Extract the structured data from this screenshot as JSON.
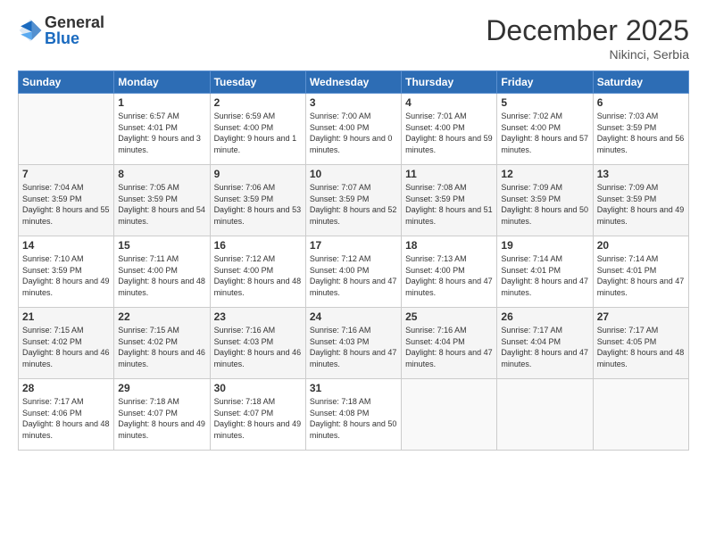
{
  "logo": {
    "text_general": "General",
    "text_blue": "Blue"
  },
  "header": {
    "month_year": "December 2025",
    "location": "Nikinci, Serbia"
  },
  "weekdays": [
    "Sunday",
    "Monday",
    "Tuesday",
    "Wednesday",
    "Thursday",
    "Friday",
    "Saturday"
  ],
  "weeks": [
    [
      {
        "day": "",
        "sunrise": "",
        "sunset": "",
        "daylight": ""
      },
      {
        "day": "1",
        "sunrise": "Sunrise: 6:57 AM",
        "sunset": "Sunset: 4:01 PM",
        "daylight": "Daylight: 9 hours and 3 minutes."
      },
      {
        "day": "2",
        "sunrise": "Sunrise: 6:59 AM",
        "sunset": "Sunset: 4:00 PM",
        "daylight": "Daylight: 9 hours and 1 minute."
      },
      {
        "day": "3",
        "sunrise": "Sunrise: 7:00 AM",
        "sunset": "Sunset: 4:00 PM",
        "daylight": "Daylight: 9 hours and 0 minutes."
      },
      {
        "day": "4",
        "sunrise": "Sunrise: 7:01 AM",
        "sunset": "Sunset: 4:00 PM",
        "daylight": "Daylight: 8 hours and 59 minutes."
      },
      {
        "day": "5",
        "sunrise": "Sunrise: 7:02 AM",
        "sunset": "Sunset: 4:00 PM",
        "daylight": "Daylight: 8 hours and 57 minutes."
      },
      {
        "day": "6",
        "sunrise": "Sunrise: 7:03 AM",
        "sunset": "Sunset: 3:59 PM",
        "daylight": "Daylight: 8 hours and 56 minutes."
      }
    ],
    [
      {
        "day": "7",
        "sunrise": "Sunrise: 7:04 AM",
        "sunset": "Sunset: 3:59 PM",
        "daylight": "Daylight: 8 hours and 55 minutes."
      },
      {
        "day": "8",
        "sunrise": "Sunrise: 7:05 AM",
        "sunset": "Sunset: 3:59 PM",
        "daylight": "Daylight: 8 hours and 54 minutes."
      },
      {
        "day": "9",
        "sunrise": "Sunrise: 7:06 AM",
        "sunset": "Sunset: 3:59 PM",
        "daylight": "Daylight: 8 hours and 53 minutes."
      },
      {
        "day": "10",
        "sunrise": "Sunrise: 7:07 AM",
        "sunset": "Sunset: 3:59 PM",
        "daylight": "Daylight: 8 hours and 52 minutes."
      },
      {
        "day": "11",
        "sunrise": "Sunrise: 7:08 AM",
        "sunset": "Sunset: 3:59 PM",
        "daylight": "Daylight: 8 hours and 51 minutes."
      },
      {
        "day": "12",
        "sunrise": "Sunrise: 7:09 AM",
        "sunset": "Sunset: 3:59 PM",
        "daylight": "Daylight: 8 hours and 50 minutes."
      },
      {
        "day": "13",
        "sunrise": "Sunrise: 7:09 AM",
        "sunset": "Sunset: 3:59 PM",
        "daylight": "Daylight: 8 hours and 49 minutes."
      }
    ],
    [
      {
        "day": "14",
        "sunrise": "Sunrise: 7:10 AM",
        "sunset": "Sunset: 3:59 PM",
        "daylight": "Daylight: 8 hours and 49 minutes."
      },
      {
        "day": "15",
        "sunrise": "Sunrise: 7:11 AM",
        "sunset": "Sunset: 4:00 PM",
        "daylight": "Daylight: 8 hours and 48 minutes."
      },
      {
        "day": "16",
        "sunrise": "Sunrise: 7:12 AM",
        "sunset": "Sunset: 4:00 PM",
        "daylight": "Daylight: 8 hours and 48 minutes."
      },
      {
        "day": "17",
        "sunrise": "Sunrise: 7:12 AM",
        "sunset": "Sunset: 4:00 PM",
        "daylight": "Daylight: 8 hours and 47 minutes."
      },
      {
        "day": "18",
        "sunrise": "Sunrise: 7:13 AM",
        "sunset": "Sunset: 4:00 PM",
        "daylight": "Daylight: 8 hours and 47 minutes."
      },
      {
        "day": "19",
        "sunrise": "Sunrise: 7:14 AM",
        "sunset": "Sunset: 4:01 PM",
        "daylight": "Daylight: 8 hours and 47 minutes."
      },
      {
        "day": "20",
        "sunrise": "Sunrise: 7:14 AM",
        "sunset": "Sunset: 4:01 PM",
        "daylight": "Daylight: 8 hours and 47 minutes."
      }
    ],
    [
      {
        "day": "21",
        "sunrise": "Sunrise: 7:15 AM",
        "sunset": "Sunset: 4:02 PM",
        "daylight": "Daylight: 8 hours and 46 minutes."
      },
      {
        "day": "22",
        "sunrise": "Sunrise: 7:15 AM",
        "sunset": "Sunset: 4:02 PM",
        "daylight": "Daylight: 8 hours and 46 minutes."
      },
      {
        "day": "23",
        "sunrise": "Sunrise: 7:16 AM",
        "sunset": "Sunset: 4:03 PM",
        "daylight": "Daylight: 8 hours and 46 minutes."
      },
      {
        "day": "24",
        "sunrise": "Sunrise: 7:16 AM",
        "sunset": "Sunset: 4:03 PM",
        "daylight": "Daylight: 8 hours and 47 minutes."
      },
      {
        "day": "25",
        "sunrise": "Sunrise: 7:16 AM",
        "sunset": "Sunset: 4:04 PM",
        "daylight": "Daylight: 8 hours and 47 minutes."
      },
      {
        "day": "26",
        "sunrise": "Sunrise: 7:17 AM",
        "sunset": "Sunset: 4:04 PM",
        "daylight": "Daylight: 8 hours and 47 minutes."
      },
      {
        "day": "27",
        "sunrise": "Sunrise: 7:17 AM",
        "sunset": "Sunset: 4:05 PM",
        "daylight": "Daylight: 8 hours and 48 minutes."
      }
    ],
    [
      {
        "day": "28",
        "sunrise": "Sunrise: 7:17 AM",
        "sunset": "Sunset: 4:06 PM",
        "daylight": "Daylight: 8 hours and 48 minutes."
      },
      {
        "day": "29",
        "sunrise": "Sunrise: 7:18 AM",
        "sunset": "Sunset: 4:07 PM",
        "daylight": "Daylight: 8 hours and 49 minutes."
      },
      {
        "day": "30",
        "sunrise": "Sunrise: 7:18 AM",
        "sunset": "Sunset: 4:07 PM",
        "daylight": "Daylight: 8 hours and 49 minutes."
      },
      {
        "day": "31",
        "sunrise": "Sunrise: 7:18 AM",
        "sunset": "Sunset: 4:08 PM",
        "daylight": "Daylight: 8 hours and 50 minutes."
      },
      {
        "day": "",
        "sunrise": "",
        "sunset": "",
        "daylight": ""
      },
      {
        "day": "",
        "sunrise": "",
        "sunset": "",
        "daylight": ""
      },
      {
        "day": "",
        "sunrise": "",
        "sunset": "",
        "daylight": ""
      }
    ]
  ]
}
